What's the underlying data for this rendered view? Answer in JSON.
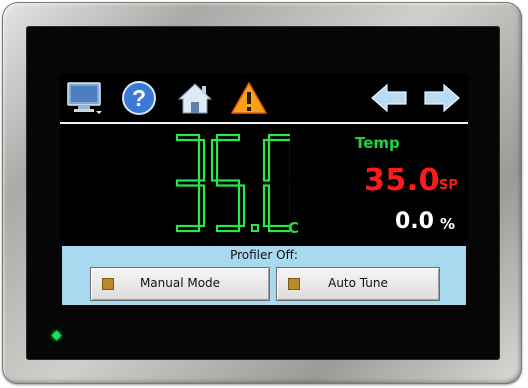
{
  "toolbar": {
    "icons": [
      "monitor-icon",
      "help-icon",
      "home-icon",
      "alarm-warning-icon",
      "back-arrow-icon",
      "forward-arrow-icon"
    ]
  },
  "readout": {
    "process_value": "35.0",
    "process_unit": "C",
    "channel_label": "Temp",
    "setpoint_value": "35.0",
    "setpoint_unit": "SP",
    "output_value": "0.0",
    "output_unit": "%"
  },
  "profiler": {
    "status": "Profiler Off:",
    "manual_mode_label": "Manual Mode",
    "auto_tune_label": "Auto Tune"
  },
  "colors": {
    "process_value": "#27e84a",
    "setpoint": "#ff1a1a",
    "panel": "#a9d9ef",
    "indicator": "#b88a28"
  }
}
